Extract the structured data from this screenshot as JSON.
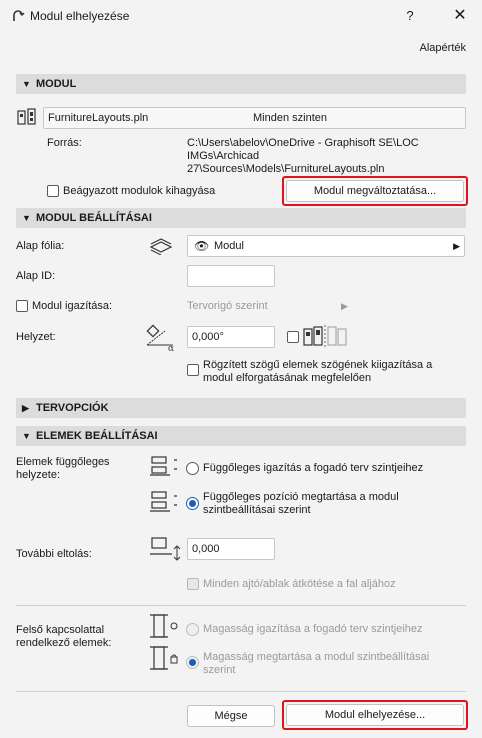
{
  "window": {
    "title": "Modul elhelyezése",
    "help": "?",
    "close": "✕"
  },
  "defaults_link": "Alapérték",
  "modul": {
    "header": "MODUL",
    "file_name": "FurnitureLayouts.pln",
    "floors": "Minden szinten",
    "source_label": "Forrás:",
    "source_path": [
      "C:\\Users\\abelov\\OneDrive - Graphisoft SE\\LOC",
      "IMGs\\Archicad",
      "27\\Sources\\Models\\FurnitureLayouts.pln"
    ],
    "skip_nested_label": "Beágyazott modulok kihagyása",
    "skip_nested_checked": false,
    "change_button": "Modul megváltoztatása..."
  },
  "settings": {
    "header": "MODUL BEÁLLÍTÁSAI",
    "base_layer_label": "Alap fólia:",
    "base_layer_value": "Modul",
    "base_id_label": "Alap ID:",
    "base_id_value": "",
    "align_label": "Modul igazítása:",
    "align_checked": false,
    "align_value": "Tervorigó szerint",
    "position_label": "Helyzet:",
    "angle_value": "0,000°",
    "fixed_angle_label": [
      "Rögzített szögű elemek szögének kiigazítása a",
      "modul elforgatásának megfelelően"
    ],
    "fixed_angle_checked": false
  },
  "plan_options": {
    "header": "TERVOPCIÓK"
  },
  "elements": {
    "header": "ELEMEK BEÁLLÍTÁSAI",
    "vertical_label": [
      "Elemek függőleges",
      "helyzete:"
    ],
    "option_align": "Függőleges igazítás a fogadó terv szintjeihez",
    "option_keep": [
      "Függőleges pozíció megtartása a modul",
      "szintbeállításai szerint"
    ],
    "selected_option": "keep",
    "offset_label": "További eltolás:",
    "offset_value": "0,000",
    "relink_label": "Minden ajtó/ablak átkötése a fal aljához",
    "top_linked_label": [
      "Felső kapcsolattal",
      "rendelkező elemek:"
    ],
    "height_align": "Magasság igazítása a fogadó terv szintjeihez",
    "height_keep": [
      "Magasság megtartása a modul szintbeállításai",
      "szerint"
    ]
  },
  "footer": {
    "cancel": "Mégse",
    "place": "Modul elhelyezése..."
  },
  "colors": {
    "highlight": "#e0141c",
    "accent": "#1a5fb4"
  }
}
